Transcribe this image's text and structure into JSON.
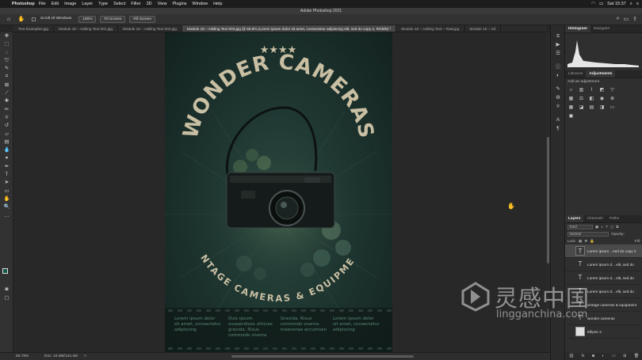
{
  "menubar": {
    "apple": "",
    "app_name": "Photoshop",
    "menus": [
      "File",
      "Edit",
      "Image",
      "Layer",
      "Type",
      "Select",
      "Filter",
      "3D",
      "View",
      "Plugins",
      "Window",
      "Help"
    ],
    "clock": "Sat 15:37"
  },
  "window": {
    "title": "Adobe Photoshop 2021"
  },
  "options": {
    "scroll_all_windows": "Scroll All Windows",
    "zoom": "100%",
    "fit_screen": "Fit Screen",
    "fill_screen": "Fill Screen"
  },
  "tabs": [
    {
      "label": "Text Examples.jpg",
      "active": false
    },
    {
      "label": "Module 16 – Adding Text 001.jpg",
      "active": false
    },
    {
      "label": "Module 16 – Adding Text 002.jpg",
      "active": false
    },
    {
      "label": "Module 16 – Adding Text 003.jpg @ 58.8% (Lorem ipsum dolor sit amet, consectetur adipiscing elit, sed do copy 2, RGB/8) *",
      "active": true
    },
    {
      "label": "Module 16 – Adding Text – Raw.jpg",
      "active": false
    },
    {
      "label": "Module 16 – Ad",
      "active": false
    }
  ],
  "poster": {
    "stars": "★★★★",
    "headline": "WONDER CAMERAS",
    "tagline": "VINTAGE CAMERAS & EQUIPMENT",
    "columns": [
      [
        "Lorem ipsum dolor",
        "sit amet, consectetur",
        "adipiscing"
      ],
      [
        "Duis ipsum",
        "suspendisse ultrices",
        "gravida. Risus",
        "commodo viverra"
      ],
      [
        "Gravida. Risus",
        "commodo viverra",
        "maecenas accumsan"
      ],
      [
        "Lorem ipsum dolor",
        "sit amet, consectetur",
        "adipiscing"
      ]
    ]
  },
  "status": {
    "zoom": "58.78%",
    "doc": "Doc: 24.9M/144.4M",
    "arrow": ">"
  },
  "panels": {
    "top_tabs": [
      "Histogram",
      "Navigator"
    ],
    "mid_tabs": [
      "Libraries",
      "Adjustments"
    ],
    "add_adjustment": "Add an adjustment",
    "layer_tabs": [
      "Layers",
      "Channels",
      "Paths"
    ],
    "kind": "Kind",
    "mode": "Normal",
    "opacity_label": "Opacity:",
    "lock_label": "Lock:",
    "fill_label": "Fill:",
    "layers": [
      {
        "name": "Lorem ipsum ...sed do copy 2",
        "type": "text",
        "selected": true
      },
      {
        "name": "Lorem ipsum d... elit, sed do",
        "type": "text",
        "selected": false
      },
      {
        "name": "Lorem ipsum d... elit, sed do",
        "type": "text",
        "selected": false
      },
      {
        "name": "Lorem ipsum d... elit, sed do",
        "type": "text",
        "selected": false
      },
      {
        "name": "vintage cameras & equipment",
        "type": "text",
        "selected": false
      },
      {
        "name": "wonder cameras",
        "type": "text",
        "selected": false
      },
      {
        "name": "Ellipse 3",
        "type": "shape",
        "selected": false
      }
    ]
  },
  "watermark": {
    "chinese": "灵感中国",
    "url": "lingganchina.com"
  },
  "colors": {
    "foreground": "#16574a",
    "background": "#ffffff",
    "poster_text": "#c9bfa3"
  }
}
